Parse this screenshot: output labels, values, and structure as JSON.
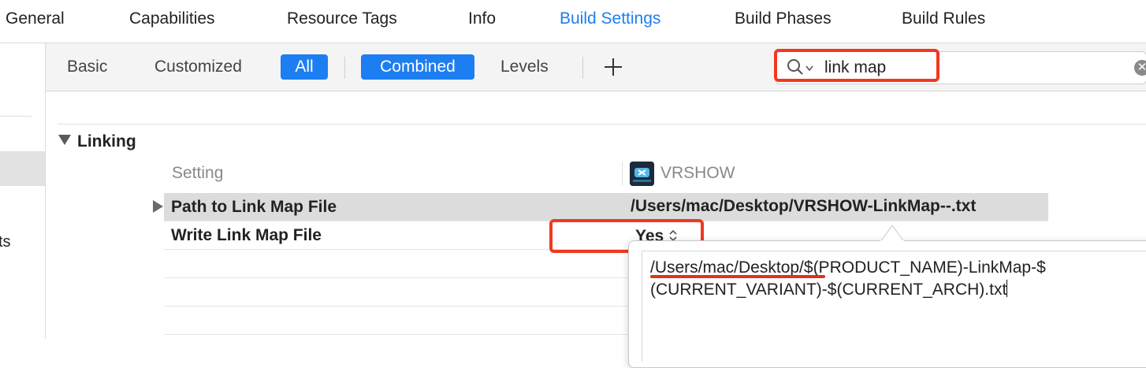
{
  "tabs": [
    {
      "label": "General",
      "active": false
    },
    {
      "label": "Capabilities",
      "active": false
    },
    {
      "label": "Resource Tags",
      "active": false
    },
    {
      "label": "Info",
      "active": false
    },
    {
      "label": "Build Settings",
      "active": true
    },
    {
      "label": "Build Phases",
      "active": false
    },
    {
      "label": "Build Rules",
      "active": false
    }
  ],
  "sidebar": {
    "partial_text": "ts"
  },
  "filter": {
    "basic": "Basic",
    "customized": "Customized",
    "all": "All",
    "combined": "Combined",
    "levels": "Levels",
    "add_icon": "plus-icon"
  },
  "search": {
    "value": "link map",
    "icon": "search-icon"
  },
  "section": {
    "title": "Linking"
  },
  "columns": {
    "setting": "Setting",
    "target": "VRSHOW"
  },
  "rows": [
    {
      "label": "Path to Link Map File",
      "value": "/Users/mac/Desktop/VRSHOW-LinkMap--.txt",
      "selected": true
    },
    {
      "label": "Write Link Map File",
      "value": "Yes",
      "selected": false
    }
  ],
  "editor": {
    "line1": "/Users/mac/Desktop/$(PRODUCT_NAME)-LinkMap-$",
    "line2": "(CURRENT_VARIANT)-$(CURRENT_ARCH).txt"
  },
  "colors": {
    "accent": "#1d7ef2",
    "annotation": "#f0391f",
    "selected_row": "#dcdcdc"
  }
}
